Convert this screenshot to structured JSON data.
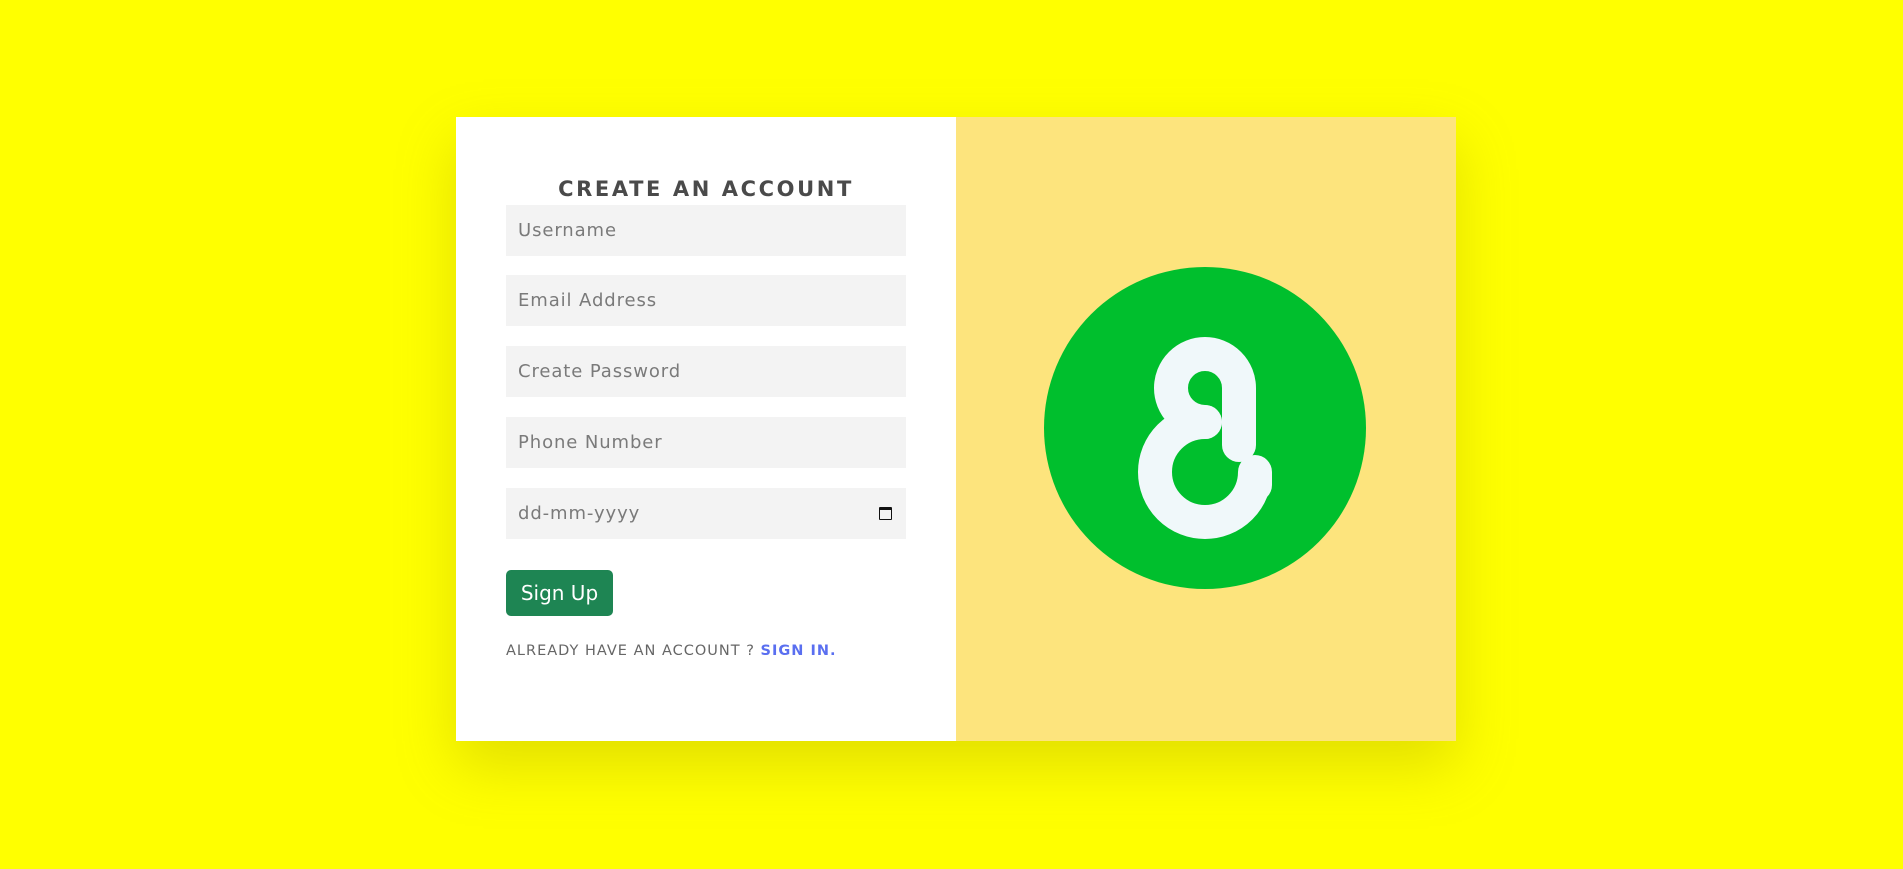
{
  "form": {
    "title": "CREATE AN ACCOUNT",
    "fields": [
      {
        "placeholder": "Username",
        "type": "text"
      },
      {
        "placeholder": "Email Address",
        "type": "email"
      },
      {
        "placeholder": "Create Password",
        "type": "password"
      },
      {
        "placeholder": "Phone Number",
        "type": "tel"
      },
      {
        "placeholder": "dd-mm-yyyy",
        "type": "date",
        "icon": "calendar-icon"
      }
    ],
    "submit_label": "Sign Up",
    "signin_prompt": "ALREADY HAVE AN ACCOUNT ?",
    "signin_link": "SIGN IN."
  },
  "brand": {
    "logo": "g-logo",
    "logo_color": "#00bf2d",
    "logo_glyph_color": "#f0f8fa"
  },
  "colors": {
    "page_background": "#ffff00",
    "panel_background": "#fde47d",
    "button_background": "#1e8553",
    "link_color": "#5a6ff0"
  }
}
